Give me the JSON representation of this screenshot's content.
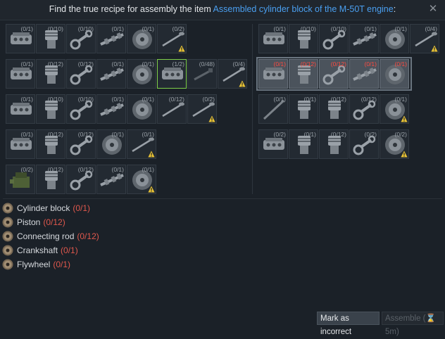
{
  "header": {
    "title_prefix": "Find the true recipe for assembly the item ",
    "title_item": "Assembled cylinder block of the M-50T engine",
    "title_suffix": ":",
    "close_label": "✕"
  },
  "recipes_left": [
    [
      {
        "icon": "cylinder-block",
        "count": "(0/1)"
      },
      {
        "icon": "piston",
        "count": "(0/10)"
      },
      {
        "icon": "connecting-rod",
        "count": "(0/10)"
      },
      {
        "icon": "crankshaft",
        "count": "(0/1)"
      },
      {
        "icon": "flywheel",
        "count": "(0/1)"
      },
      {
        "icon": "valve",
        "count": "(0/2)",
        "warn": true
      }
    ],
    [
      {
        "icon": "cylinder-block",
        "count": "(0/1)"
      },
      {
        "icon": "piston",
        "count": "(0/12)"
      },
      {
        "icon": "connecting-rod",
        "count": "(0/12)"
      },
      {
        "icon": "crankshaft",
        "count": "(0/1)"
      },
      {
        "icon": "flywheel",
        "count": "(0/1)"
      },
      {
        "icon": "cylinder-block",
        "count": "(1/2)",
        "selected": true
      },
      {
        "icon": "bolt",
        "count": "(0/48)"
      },
      {
        "icon": "valve",
        "count": "(0/4)",
        "warn": true
      }
    ],
    [
      {
        "icon": "cylinder-block",
        "count": "(0/1)"
      },
      {
        "icon": "piston",
        "count": "(0/10)"
      },
      {
        "icon": "connecting-rod",
        "count": "(0/10)"
      },
      {
        "icon": "crankshaft",
        "count": "(0/1)"
      },
      {
        "icon": "flywheel",
        "count": "(0/1)"
      },
      {
        "icon": "valve",
        "count": "(0/12)"
      },
      {
        "icon": "valve",
        "count": "(0/2)",
        "warn": true
      }
    ],
    [
      {
        "icon": "cylinder-block",
        "count": "(0/1)"
      },
      {
        "icon": "piston",
        "count": "(0/12)"
      },
      {
        "icon": "connecting-rod",
        "count": "(0/12)"
      },
      {
        "icon": "flywheel",
        "count": "(0/1)"
      },
      {
        "icon": "valve",
        "count": "(0/1)",
        "warn": true
      }
    ],
    [
      {
        "icon": "engine",
        "count": "(0/2)"
      },
      {
        "icon": "piston",
        "count": "(0/12)"
      },
      {
        "icon": "connecting-rod",
        "count": "(0/12)"
      },
      {
        "icon": "crankshaft",
        "count": "(0/1)"
      },
      {
        "icon": "flywheel",
        "count": "(0/1)",
        "warn": true
      }
    ]
  ],
  "recipes_right": [
    [
      {
        "icon": "cylinder-block",
        "count": "(0/1)"
      },
      {
        "icon": "piston",
        "count": "(0/10)"
      },
      {
        "icon": "connecting-rod",
        "count": "(0/10)"
      },
      {
        "icon": "crankshaft",
        "count": "(0/1)"
      },
      {
        "icon": "flywheel",
        "count": "(0/1)"
      },
      {
        "icon": "valve",
        "count": "(0/4)",
        "warn": true
      }
    ],
    [
      {
        "icon": "cylinder-block",
        "count": "(0/1)",
        "bright": true
      },
      {
        "icon": "piston",
        "count": "(0/12)",
        "bright": true
      },
      {
        "icon": "connecting-rod",
        "count": "(0/12)",
        "bright": true
      },
      {
        "icon": "crankshaft",
        "count": "(0/1)",
        "bright": true
      },
      {
        "icon": "flywheel",
        "count": "(0/1)",
        "bright": true
      }
    ],
    [
      {
        "icon": "rod",
        "count": "(0/1)"
      },
      {
        "icon": "piston",
        "count": "(0/1)"
      },
      {
        "icon": "piston",
        "count": "(0/12)"
      },
      {
        "icon": "connecting-rod",
        "count": "(0/12)"
      },
      {
        "icon": "flywheel",
        "count": "(0/1)",
        "warn": true
      }
    ],
    [
      {
        "icon": "cylinder-block",
        "count": "(0/2)"
      },
      {
        "icon": "piston",
        "count": "(0/1)"
      },
      {
        "icon": "piston",
        "count": "(0/12)"
      },
      {
        "icon": "connecting-rod",
        "count": "(0/2)"
      },
      {
        "icon": "flywheel",
        "count": "(0/2)",
        "warn": true
      }
    ]
  ],
  "requirements": [
    {
      "name": "Cylinder block",
      "need": "(0/1)"
    },
    {
      "name": "Piston",
      "need": "(0/12)"
    },
    {
      "name": "Connecting rod",
      "need": "(0/12)"
    },
    {
      "name": "Crankshaft",
      "need": "(0/1)"
    },
    {
      "name": "Flywheel",
      "need": "(0/1)"
    }
  ],
  "buttons": {
    "mark_incorrect": "Mark as incorrect",
    "assemble": "Assemble (⌛ 5m)"
  },
  "colors": {
    "accent": "#4a9ff0",
    "need": "#e0584d",
    "selected": "#7fd04a",
    "warning": "#e8c235"
  }
}
